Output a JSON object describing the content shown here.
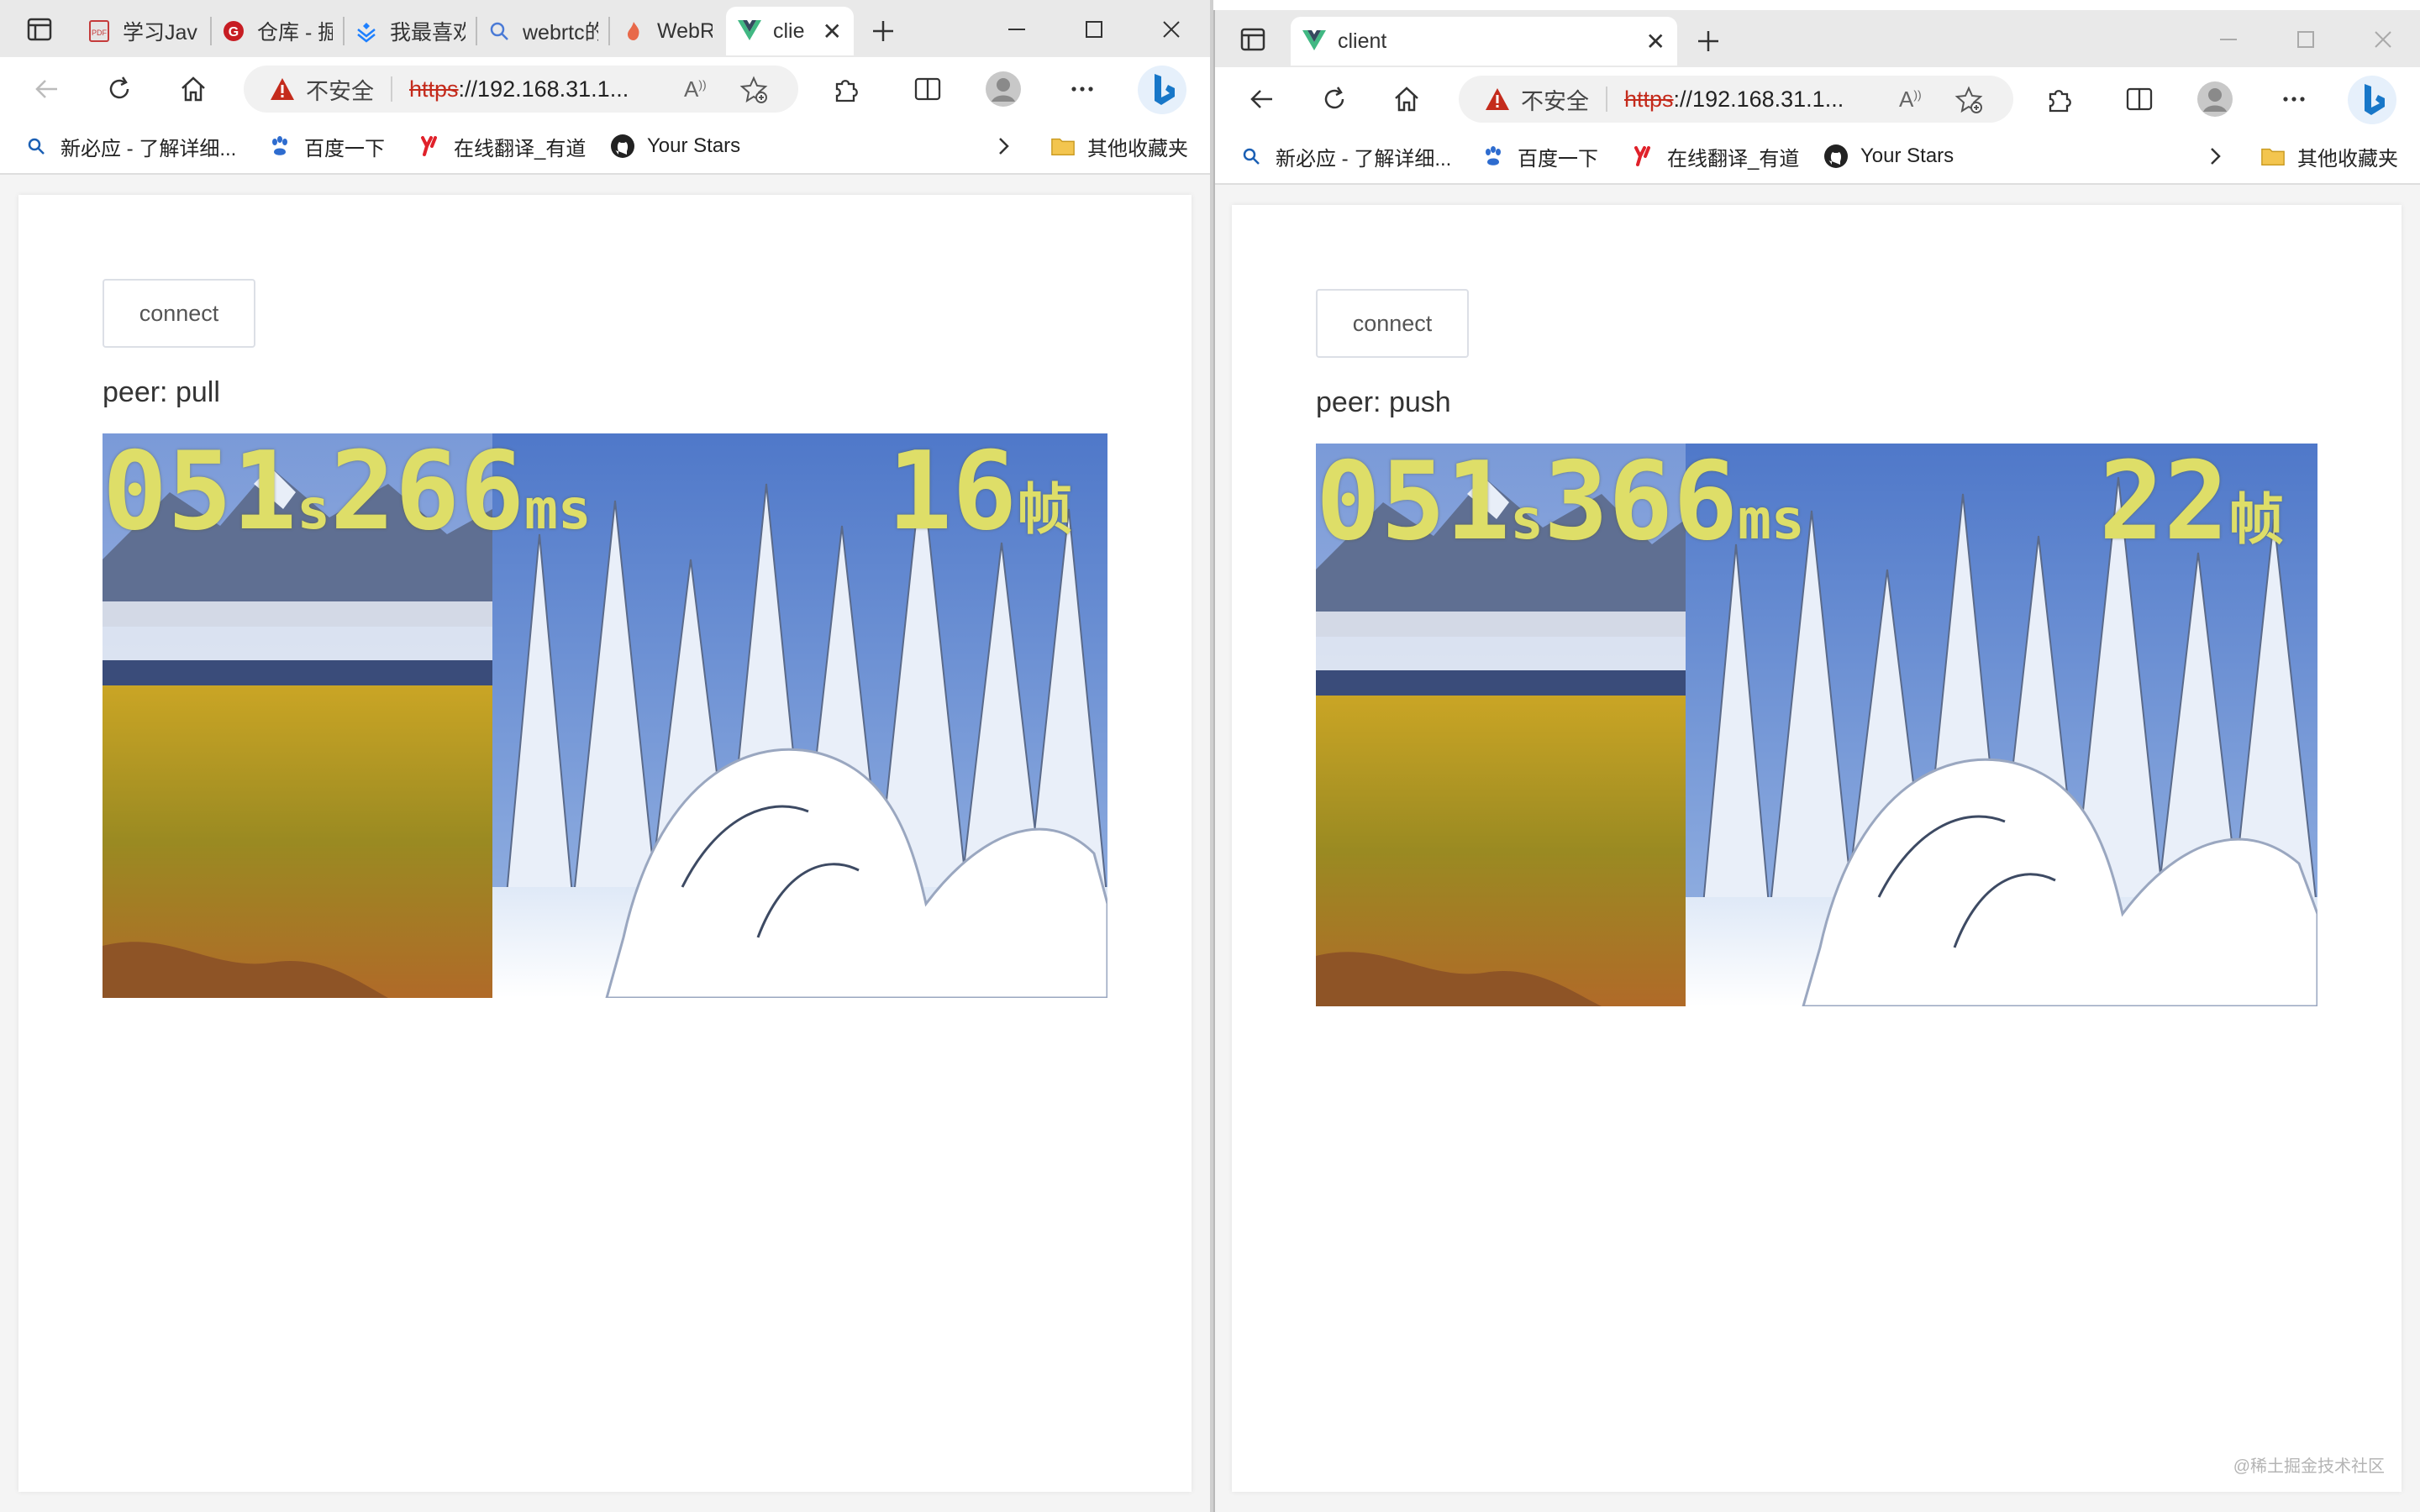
{
  "left": {
    "tabs": [
      {
        "title": "学习Jav"
      },
      {
        "title": "仓库 - 掘"
      },
      {
        "title": "我最喜欢"
      },
      {
        "title": "webrtc的"
      },
      {
        "title": "WebRTC"
      },
      {
        "title": "clie"
      }
    ],
    "address": {
      "not_secure": "不安全",
      "scheme": "https",
      "rest": "://192.168.31.1..."
    },
    "bookmarks": [
      "新必应 - 了解详细...",
      "百度一下",
      "在线翻译_有道",
      "Your Stars"
    ],
    "other_bookmarks": "其他收藏夹",
    "connect_label": "connect",
    "peer_label": "peer: pull",
    "overlay": {
      "seconds": "051",
      "s_unit": "s",
      "ms": "266",
      "ms_unit": "ms",
      "frames": "16",
      "frames_unit": "帧"
    }
  },
  "right": {
    "tabs": [
      {
        "title": "client"
      }
    ],
    "address": {
      "not_secure": "不安全",
      "scheme": "https",
      "rest": "://192.168.31.1..."
    },
    "bookmarks": [
      "新必应 - 了解详细...",
      "百度一下",
      "在线翻译_有道",
      "Your Stars"
    ],
    "other_bookmarks": "其他收藏夹",
    "connect_label": "connect",
    "peer_label": "peer: push",
    "overlay": {
      "seconds": "051",
      "s_unit": "s",
      "ms": "366",
      "ms_unit": "ms",
      "frames": "22",
      "frames_unit": "帧"
    }
  },
  "watermark": "@稀土掘金技术社区",
  "colors": {
    "overlay_text": "#dede68",
    "warning": "#c42b1c",
    "vue_green": "#41b883",
    "bing_blue": "#1877c8"
  }
}
